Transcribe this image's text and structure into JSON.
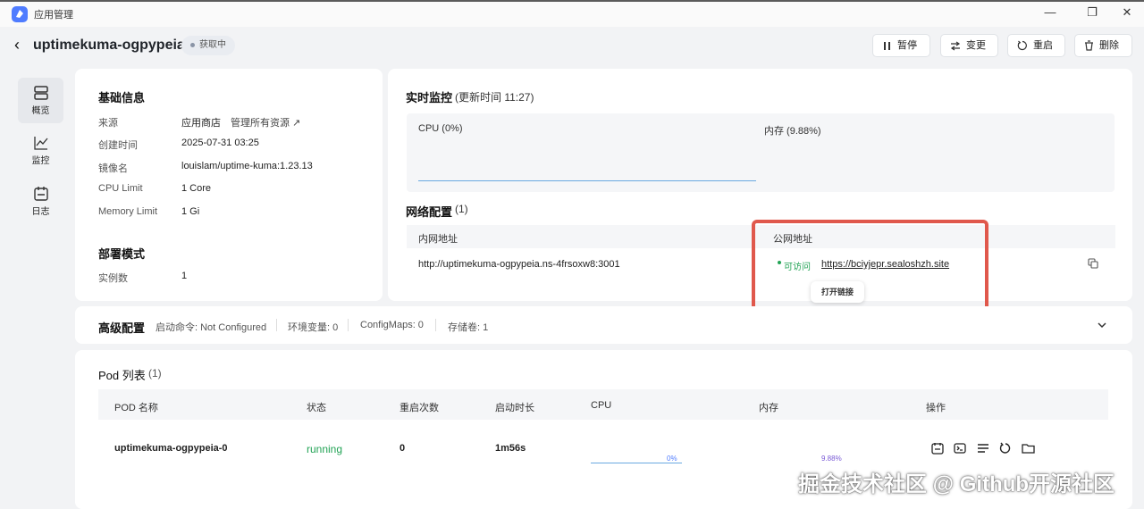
{
  "window": {
    "app_title": "应用管理",
    "minimize": "—",
    "restore": "❐",
    "close": "✕"
  },
  "header": {
    "back": "‹",
    "title": "uptimekuma-ogpypeia",
    "status": "获取中"
  },
  "actions": [
    {
      "icon": "pause-icon",
      "label": "暂停"
    },
    {
      "icon": "swap-icon",
      "label": "变更"
    },
    {
      "icon": "restart-icon",
      "label": "重启"
    },
    {
      "icon": "trash-icon",
      "label": "删除"
    }
  ],
  "nav": [
    {
      "label": "概览",
      "icon": "server-icon",
      "active": true
    },
    {
      "label": "监控",
      "icon": "chart-icon",
      "active": false
    },
    {
      "label": "日志",
      "icon": "log-icon",
      "active": false
    }
  ],
  "basic": {
    "title": "基础信息",
    "rows": [
      {
        "label": "来源",
        "value": "应用商店",
        "extra": "管理所有资源 ↗"
      },
      {
        "label": "创建时间",
        "value": "2025-07-31 03:25"
      },
      {
        "label": "镜像名",
        "value": "louislam/uptime-kuma:1.23.13"
      },
      {
        "label": "CPU Limit",
        "value": "1 Core"
      },
      {
        "label": "Memory Limit",
        "value": "1 Gi"
      }
    ]
  },
  "deploy": {
    "title": "部署模式",
    "rows": [
      {
        "label": "实例数",
        "value": "1"
      }
    ]
  },
  "monitor": {
    "title": "实时监控",
    "updated": "(更新时间 11:27)",
    "cpu_label": "CPU (0%)",
    "mem_label": "内存 (9.88%)"
  },
  "network": {
    "title": "网络配置",
    "count": "(1)",
    "col_internal": "内网地址",
    "col_public": "公网地址",
    "internal": "http://uptimekuma-ogpypeia.ns-4frsoxw8:3001",
    "status": "可访问",
    "public": "https://bciyjepr.sealoshzh.site",
    "tooltip": "打开链接",
    "copy_icon": "copy-icon"
  },
  "advanced": {
    "title": "高级配置",
    "start_cmd": "启动命令: Not Configured",
    "env": "环境变量: 0",
    "configmaps": "ConfigMaps: 0",
    "storage": "存储卷: 1"
  },
  "pods": {
    "title": "Pod 列表",
    "count": "(1)",
    "headers": [
      "POD 名称",
      "状态",
      "重启次数",
      "启动时长",
      "CPU",
      "内存",
      "操作"
    ],
    "rows": [
      {
        "name": "uptimekuma-ogpypeia-0",
        "status": "running",
        "restarts": "0",
        "uptime": "1m56s",
        "cpu": "0%",
        "mem": "9.88%"
      }
    ],
    "op_icons": [
      "log-icon",
      "terminal-icon",
      "detail-icon",
      "restart-icon",
      "folder-icon"
    ]
  },
  "colors": {
    "accent": "#4f7cff",
    "running": "#22a355",
    "highlight": "#e0584c",
    "chart": "#6aa8e0"
  },
  "watermark": "掘金技术社区 @ Github开源社区"
}
